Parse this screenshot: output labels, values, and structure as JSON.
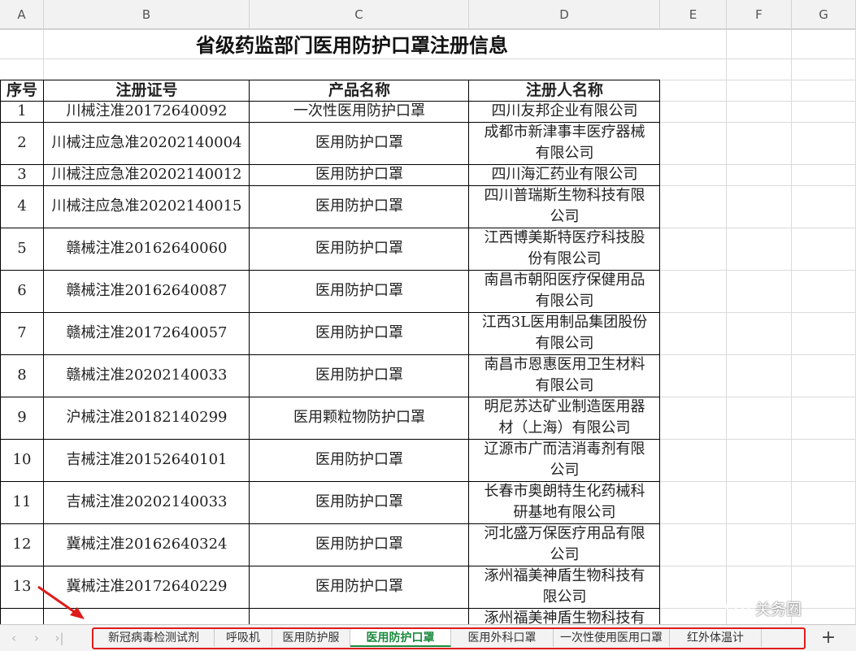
{
  "columns": [
    "A",
    "B",
    "C",
    "D",
    "E",
    "F",
    "G"
  ],
  "title": "省级药监部门医用防护口罩注册信息",
  "headers": {
    "seq": "序号",
    "reg": "注册证号",
    "product": "产品名称",
    "registrant": "注册人名称"
  },
  "rows": [
    {
      "seq": "1",
      "reg": "川械注准20172640092",
      "product": "一次性医用防护口罩",
      "registrant": [
        "四川友邦企业有限公司"
      ]
    },
    {
      "seq": "2",
      "reg": "川械注应急准20202140004",
      "product": "医用防护口罩",
      "registrant": [
        "成都市新津事丰医疗器械",
        "有限公司"
      ]
    },
    {
      "seq": "3",
      "reg": "川械注应急准20202140012",
      "product": "医用防护口罩",
      "registrant": [
        "四川海汇药业有限公司"
      ]
    },
    {
      "seq": "4",
      "reg": "川械注应急准20202140015",
      "product": "医用防护口罩",
      "registrant": [
        "四川普瑞斯生物科技有限",
        "公司"
      ]
    },
    {
      "seq": "5",
      "reg": "赣械注准20162640060",
      "product": "医用防护口罩",
      "registrant": [
        "江西博美斯特医疗科技股",
        "份有限公司"
      ]
    },
    {
      "seq": "6",
      "reg": "赣械注准20162640087",
      "product": "医用防护口罩",
      "registrant": [
        "南昌市朝阳医疗保健用品",
        "有限公司"
      ]
    },
    {
      "seq": "7",
      "reg": "赣械注准20172640057",
      "product": "医用防护口罩",
      "registrant": [
        "江西3L医用制品集团股份",
        "有限公司"
      ]
    },
    {
      "seq": "8",
      "reg": "赣械注准20202140033",
      "product": "医用防护口罩",
      "registrant": [
        "南昌市恩惠医用卫生材料",
        "有限公司"
      ]
    },
    {
      "seq": "9",
      "reg": "沪械注准20182140299",
      "product": "医用颗粒物防护口罩",
      "registrant": [
        "明尼苏达矿业制造医用器",
        "材（上海）有限公司"
      ]
    },
    {
      "seq": "10",
      "reg": "吉械注准20152640101",
      "product": "医用防护口罩",
      "registrant": [
        "辽源市广而洁消毒剂有限",
        "公司"
      ]
    },
    {
      "seq": "11",
      "reg": "吉械注准20202140033",
      "product": "医用防护口罩",
      "registrant": [
        "长春市奥朗特生化药械科",
        "研基地有限公司"
      ]
    },
    {
      "seq": "12",
      "reg": "冀械注准20162640324",
      "product": "医用防护口罩",
      "registrant": [
        "河北盛万保医疗用品有限",
        "公司"
      ]
    },
    {
      "seq": "13",
      "reg": "冀械注准20172640229",
      "product": "医用防护口罩",
      "registrant": [
        "涿州福美神盾生物科技有",
        "限公司"
      ]
    },
    {
      "seq": "",
      "reg": "",
      "product": "",
      "registrant": [
        "涿州福美神盾生物科技有"
      ]
    }
  ],
  "tabs": [
    "新冠病毒检测试剂",
    "呼吸机",
    "医用防护服",
    "医用防护口罩",
    "医用外科口罩",
    "一次性使用医用口罩",
    "红外体温计"
  ],
  "active_tab": "医用防护口罩",
  "add_tab_label": "+",
  "nav": [
    "‹",
    "›",
    "›|"
  ],
  "watermark": "关务圈",
  "colors": {
    "accent_tab": "#1a8a3e",
    "highlight_box": "#e01b1b",
    "arrow": "#e01b1b"
  }
}
